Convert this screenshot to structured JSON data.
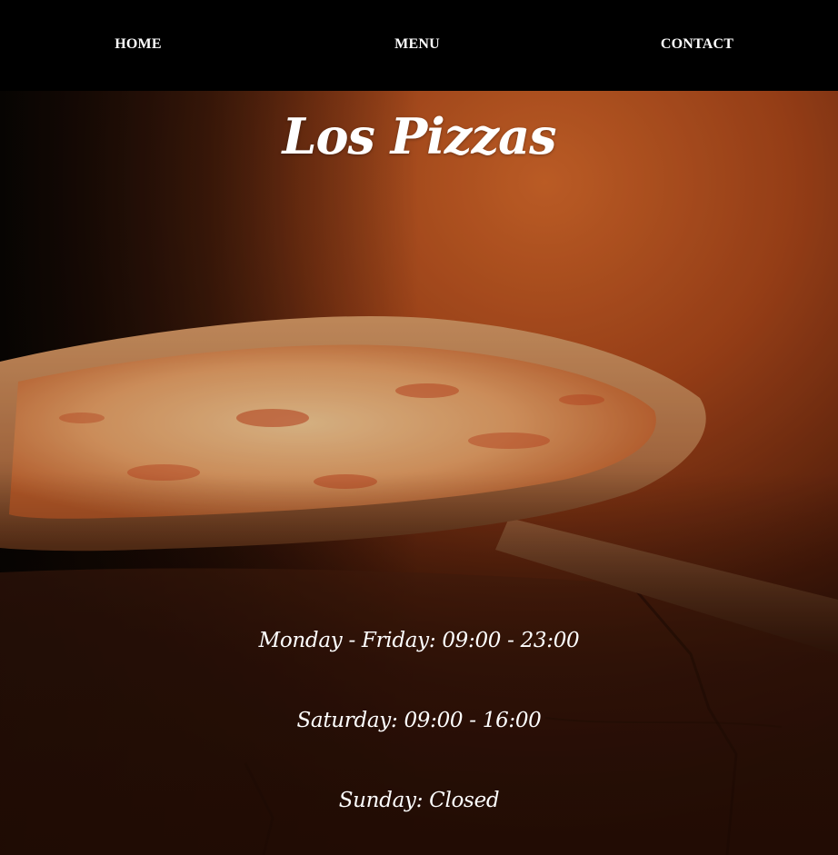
{
  "nav": {
    "home": "HOME",
    "menu": "MENU",
    "contact": "CONTACT"
  },
  "hero": {
    "title": "Los Pizzas",
    "image_subject": "pizza on wooden peel in brick oven",
    "hours": [
      "Monday - Friday: 09:00 - 23:00",
      "Saturday: 09:00 - 16:00",
      "Sunday: Closed"
    ]
  },
  "colors": {
    "nav_bg": "#000000",
    "text": "#ffffff",
    "oven_glow": "#c2501a"
  }
}
